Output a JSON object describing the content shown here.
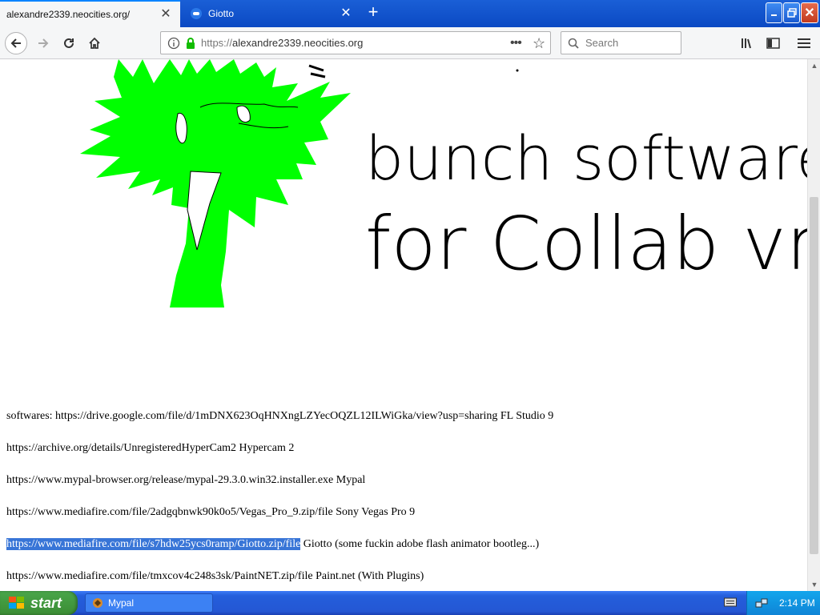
{
  "tabs": [
    {
      "title": "alexandre2339.neocities.org/",
      "active": true
    },
    {
      "title": "Giotto",
      "active": false
    }
  ],
  "nav": {
    "url_prefix": "https://",
    "url_domain": "alexandre2339.neocities.org",
    "search_placeholder": "Search"
  },
  "drawing": {
    "line1": "bunch softwares",
    "line2": "for Collab vm!",
    "tree_color": "#00ff00"
  },
  "content": {
    "lines": [
      {
        "text": "softwares: https://drive.google.com/file/d/1mDNX623OqHNXngLZYecOQZL12ILWiGka/view?usp=sharing FL Studio 9"
      },
      {
        "text": "https://archive.org/details/UnregisteredHyperCam2 Hypercam 2"
      },
      {
        "text": "https://www.mypal-browser.org/release/mypal-29.3.0.win32.installer.exe Mypal"
      },
      {
        "text": "https://www.mediafire.com/file/2adgqbnwk90k0o5/Vegas_Pro_9.zip/file Sony Vegas Pro 9"
      },
      {
        "selected": "https://www.mediafire.com/file/s7hdw25ycs0ramp/Giotto.zip/file",
        "rest": " Giotto (some fuckin adobe flash animator bootleg...)"
      },
      {
        "text": "https://www.mediafire.com/file/tmxcov4c248s3sk/PaintNET.zip/file Paint.net (With Plugins)"
      }
    ]
  },
  "taskbar": {
    "start_label": "start",
    "task_label": "Mypal",
    "clock": "2:14 PM"
  }
}
